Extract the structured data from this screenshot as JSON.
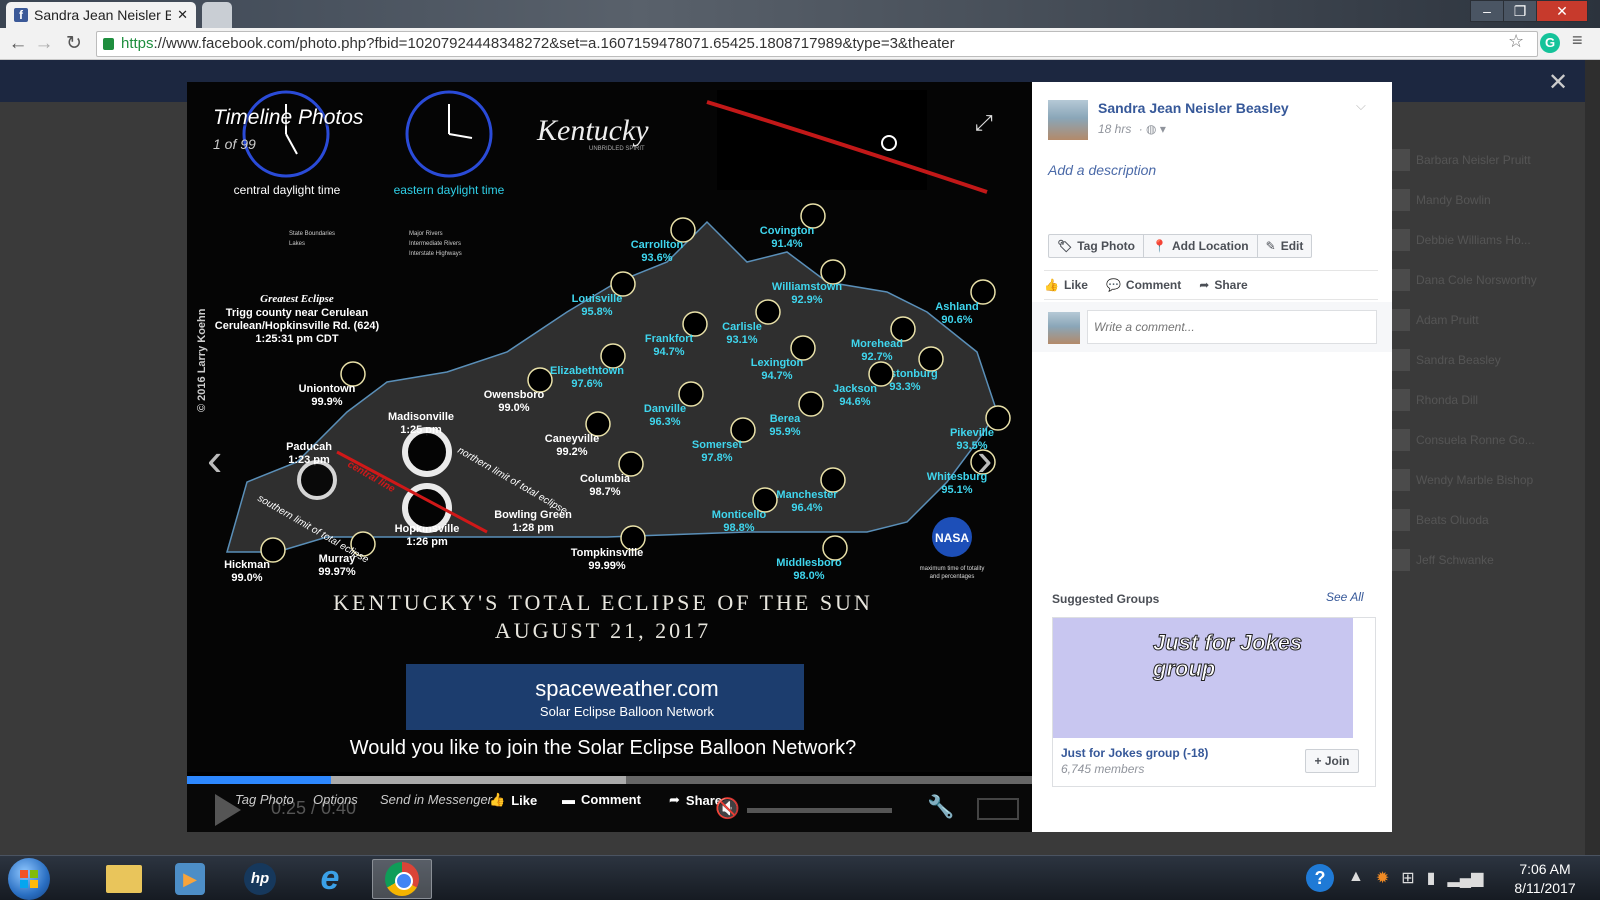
{
  "browser": {
    "tab_title": "Sandra Jean Neisler B",
    "url_https": "https",
    "url_rest": "://www.facebook.com/photo.php?fbid=10207924448348272&set=a.1607159478071.65425.1808717989&type=3&theater"
  },
  "viewer": {
    "title": "Timeline Photos",
    "count": "1 of 99",
    "image_text": {
      "clock1_label": "central daylight time",
      "clock2_label": "eastern daylight time",
      "brand": "Kentucky",
      "brand_tag": "UNBRIDLED SPIRIT",
      "legend": [
        "State Boundaries",
        "Lakes",
        "Major Rivers",
        "Intermediate Rivers",
        "Interstate Highways"
      ],
      "greatest_title": "Greatest Eclipse",
      "greatest_lines": [
        "Trigg county near Cerulean",
        "Cerulean/Hopkinsville Rd. (624)",
        "1:25:31 pm CDT"
      ],
      "copyright": "© 2016 Larry Koehn",
      "poster_title": "KENTUCKY'S TOTAL ECLIPSE OF THE SUN",
      "poster_date": "AUGUST 21, 2017",
      "banner_name": "spaceweather.com",
      "banner_sub": "Solar Eclipse Balloon Network",
      "cta": "Would you like to join the Solar Eclipse Balloon Network?",
      "nasa": "NASA",
      "nasa_note": [
        "maximum time of totality",
        "and percentages"
      ],
      "limit_north": "northern limit of total eclipse",
      "limit_south": "southern limit of total eclipse",
      "centerline": "central line"
    },
    "cities": [
      {
        "name": "Covington",
        "pct": "91.4%"
      },
      {
        "name": "Carrollton",
        "pct": "93.6%"
      },
      {
        "name": "Williamstown",
        "pct": "92.9%"
      },
      {
        "name": "Louisville",
        "pct": "95.8%"
      },
      {
        "name": "Ashland",
        "pct": "90.6%"
      },
      {
        "name": "Carlisle",
        "pct": "93.1%"
      },
      {
        "name": "Frankfort",
        "pct": "94.7%"
      },
      {
        "name": "Morehead",
        "pct": "92.7%"
      },
      {
        "name": "Lexington",
        "pct": "94.7%"
      },
      {
        "name": "Prestonburg",
        "pct": "93.3%"
      },
      {
        "name": "Elizabethtown",
        "pct": "97.6%"
      },
      {
        "name": "Jackson",
        "pct": "94.6%"
      },
      {
        "name": "Owensboro",
        "pct": "99.0%"
      },
      {
        "name": "Danville",
        "pct": "96.3%"
      },
      {
        "name": "Berea",
        "pct": "95.9%"
      },
      {
        "name": "Pikeville",
        "pct": "93.5%"
      },
      {
        "name": "Uniontown",
        "pct": "99.9%"
      },
      {
        "name": "Caneyville",
        "pct": "99.2%"
      },
      {
        "name": "Somerset",
        "pct": "97.8%"
      },
      {
        "name": "Whitesburg",
        "pct": "95.1%"
      },
      {
        "name": "Columbia",
        "pct": "98.7%"
      },
      {
        "name": "Manchester",
        "pct": "96.4%"
      },
      {
        "name": "Monticello",
        "pct": "98.8%"
      },
      {
        "name": "Tompkinsville",
        "pct": "99.99%"
      },
      {
        "name": "Middlesboro",
        "pct": "98.0%"
      },
      {
        "name": "Hickman",
        "pct": "99.0%"
      },
      {
        "name": "Murray",
        "pct": "99.97%"
      }
    ],
    "timed_cities": [
      {
        "name": "Madisonville",
        "time": "1:25 pm"
      },
      {
        "name": "Paducah",
        "time": "1:23 pm"
      },
      {
        "name": "Hopkinsville",
        "time": "1:26 pm"
      },
      {
        "name": "Bowling Green",
        "time": "1:28 pm"
      }
    ],
    "controls": {
      "tag_photo": "Tag Photo",
      "options": "Options",
      "send_in_messenger": "Send in Messenger",
      "like": "Like",
      "comment": "Comment",
      "share": "Share",
      "time": "0:25 / 0:40",
      "progress": 0.17,
      "buffered": 0.52
    }
  },
  "post": {
    "author": "Sandra Jean Neisler Beasley",
    "time": "18 hrs",
    "add_description": "Add a description",
    "actions": {
      "tag": "Tag Photo",
      "location": "Add Location",
      "edit": "Edit"
    },
    "ufi": {
      "like": "Like",
      "comment": "Comment",
      "share": "Share"
    },
    "comment_placeholder": "Write a comment..."
  },
  "suggested": {
    "title": "Suggested Groups",
    "see_all": "See All",
    "cover_text": "Just for Jokes group",
    "group_name": "Just for Jokes group (-18)",
    "members": "6,745 members",
    "join": "+ Join"
  },
  "background_friends": [
    "Barbara Neisler Pruitt",
    "Mandy Bowlin",
    "Debbie Williams Ho...",
    "Dana Cole Norsworthy",
    "Adam Pruitt",
    "Sandra Beasley",
    "Rhonda Dill",
    "Consuela Ronne Go...",
    "Wendy Marble Bishop",
    "Beats Oluoda",
    "Jeff Schwanke"
  ],
  "taskbar": {
    "time": "7:06 AM",
    "date": "8/11/2017"
  }
}
